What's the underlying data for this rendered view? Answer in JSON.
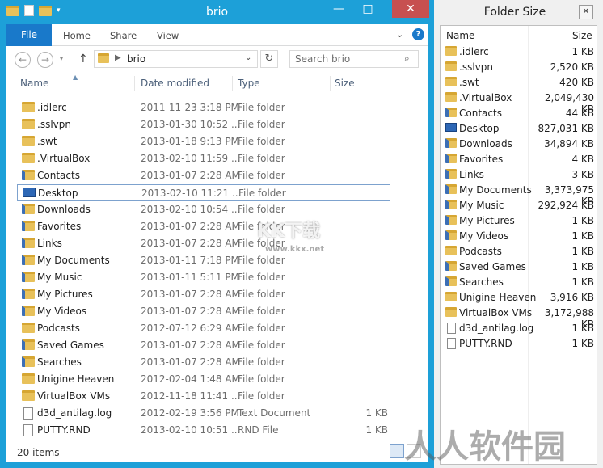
{
  "explorer": {
    "title": "brio",
    "window_controls": {
      "minimize": "—",
      "maximize": "□",
      "close": "✕"
    },
    "ribbon_tabs": [
      "File",
      "Home",
      "Share",
      "View"
    ],
    "ribbon_expand": "⌄",
    "help": "?",
    "address": {
      "back": "←",
      "forward": "→",
      "up": "↑",
      "sep": "▶",
      "path": "brio",
      "dropdown": "⌄",
      "refresh": "↻"
    },
    "search": {
      "placeholder": "Search brio",
      "icon": "⌕"
    },
    "columns": {
      "name": "Name",
      "date": "Date modified",
      "type": "Type",
      "size": "Size"
    },
    "sort_indicator": "▲",
    "files": [
      {
        "name": ".idlerc",
        "date": "2011-11-23 3:18 PM",
        "type": "File folder",
        "size": "",
        "icon": "folder-icon"
      },
      {
        "name": ".sslvpn",
        "date": "2013-01-30 10:52 ...",
        "type": "File folder",
        "size": "",
        "icon": "folder-icon"
      },
      {
        "name": ".swt",
        "date": "2013-01-18 9:13 PM",
        "type": "File folder",
        "size": "",
        "icon": "folder-icon"
      },
      {
        "name": ".VirtualBox",
        "date": "2013-02-10 11:59 ...",
        "type": "File folder",
        "size": "",
        "icon": "folder-icon"
      },
      {
        "name": "Contacts",
        "date": "2013-01-07 2:28 AM",
        "type": "File folder",
        "size": "",
        "icon": "contacts-folder-icon"
      },
      {
        "name": "Desktop",
        "date": "2013-02-10 11:21 ...",
        "type": "File folder",
        "size": "",
        "icon": "desktop-folder-icon",
        "selected": true
      },
      {
        "name": "Downloads",
        "date": "2013-02-10 10:54 ...",
        "type": "File folder",
        "size": "",
        "icon": "downloads-folder-icon"
      },
      {
        "name": "Favorites",
        "date": "2013-01-07 2:28 AM",
        "type": "File folder",
        "size": "",
        "icon": "favorites-folder-icon"
      },
      {
        "name": "Links",
        "date": "2013-01-07 2:28 AM",
        "type": "File folder",
        "size": "",
        "icon": "links-folder-icon"
      },
      {
        "name": "My Documents",
        "date": "2013-01-11 7:18 PM",
        "type": "File folder",
        "size": "",
        "icon": "documents-folder-icon"
      },
      {
        "name": "My Music",
        "date": "2013-01-11 5:11 PM",
        "type": "File folder",
        "size": "",
        "icon": "music-folder-icon"
      },
      {
        "name": "My Pictures",
        "date": "2013-01-07 2:28 AM",
        "type": "File folder",
        "size": "",
        "icon": "pictures-folder-icon"
      },
      {
        "name": "My Videos",
        "date": "2013-01-07 2:28 AM",
        "type": "File folder",
        "size": "",
        "icon": "videos-folder-icon"
      },
      {
        "name": "Podcasts",
        "date": "2012-07-12 6:29 AM",
        "type": "File folder",
        "size": "",
        "icon": "folder-icon"
      },
      {
        "name": "Saved Games",
        "date": "2013-01-07 2:28 AM",
        "type": "File folder",
        "size": "",
        "icon": "saved-games-folder-icon"
      },
      {
        "name": "Searches",
        "date": "2013-01-07 2:28 AM",
        "type": "File folder",
        "size": "",
        "icon": "searches-folder-icon"
      },
      {
        "name": "Unigine Heaven",
        "date": "2012-02-04 1:48 AM",
        "type": "File folder",
        "size": "",
        "icon": "folder-icon"
      },
      {
        "name": "VirtualBox VMs",
        "date": "2012-11-18 11:41 ...",
        "type": "File folder",
        "size": "",
        "icon": "folder-icon"
      },
      {
        "name": "d3d_antilag.log",
        "date": "2012-02-19 3:56 PM",
        "type": "Text Document",
        "size": "1 KB",
        "icon": "text-document-icon"
      },
      {
        "name": "PUTTY.RND",
        "date": "2013-02-10 10:51 ...",
        "type": "RND File",
        "size": "1 KB",
        "icon": "file-icon"
      }
    ],
    "status": "20 items"
  },
  "folder_size": {
    "title": "Folder Size",
    "close": "✕",
    "columns": {
      "name": "Name",
      "size": "Size"
    },
    "rows": [
      {
        "name": ".idlerc",
        "size": "1 KB",
        "icon": "folder-icon"
      },
      {
        "name": ".sslvpn",
        "size": "2,520 KB",
        "icon": "folder-icon"
      },
      {
        "name": ".swt",
        "size": "420 KB",
        "icon": "folder-icon"
      },
      {
        "name": ".VirtualBox",
        "size": "2,049,430 KB",
        "icon": "folder-icon"
      },
      {
        "name": "Contacts",
        "size": "44 KB",
        "icon": "contacts-folder-icon"
      },
      {
        "name": "Desktop",
        "size": "827,031 KB",
        "icon": "desktop-folder-icon"
      },
      {
        "name": "Downloads",
        "size": "34,894 KB",
        "icon": "downloads-folder-icon"
      },
      {
        "name": "Favorites",
        "size": "4 KB",
        "icon": "favorites-folder-icon"
      },
      {
        "name": "Links",
        "size": "3 KB",
        "icon": "links-folder-icon"
      },
      {
        "name": "My Documents",
        "size": "3,373,975 KB",
        "icon": "documents-folder-icon"
      },
      {
        "name": "My Music",
        "size": "292,924 KB",
        "icon": "music-folder-icon"
      },
      {
        "name": "My Pictures",
        "size": "1 KB",
        "icon": "pictures-folder-icon"
      },
      {
        "name": "My Videos",
        "size": "1 KB",
        "icon": "videos-folder-icon"
      },
      {
        "name": "Podcasts",
        "size": "1 KB",
        "icon": "folder-icon"
      },
      {
        "name": "Saved Games",
        "size": "1 KB",
        "icon": "saved-games-folder-icon"
      },
      {
        "name": "Searches",
        "size": "1 KB",
        "icon": "searches-folder-icon"
      },
      {
        "name": "Unigine Heaven",
        "size": "3,916 KB",
        "icon": "folder-icon"
      },
      {
        "name": "VirtualBox VMs",
        "size": "3,172,988 KB",
        "icon": "folder-icon"
      },
      {
        "name": "d3d_antilag.log",
        "size": "1 KB",
        "icon": "text-document-icon"
      },
      {
        "name": "PUTTY.RND",
        "size": "1 KB",
        "icon": "file-icon"
      }
    ]
  },
  "watermarks": {
    "kk": "KK下载",
    "kk_url": "www.kkx.net",
    "brand": "人人软件园"
  },
  "colors": {
    "accent": "#1da0d8",
    "file_tab": "#1979ca",
    "close": "#c75050",
    "selection_border": "#7da2ce"
  }
}
